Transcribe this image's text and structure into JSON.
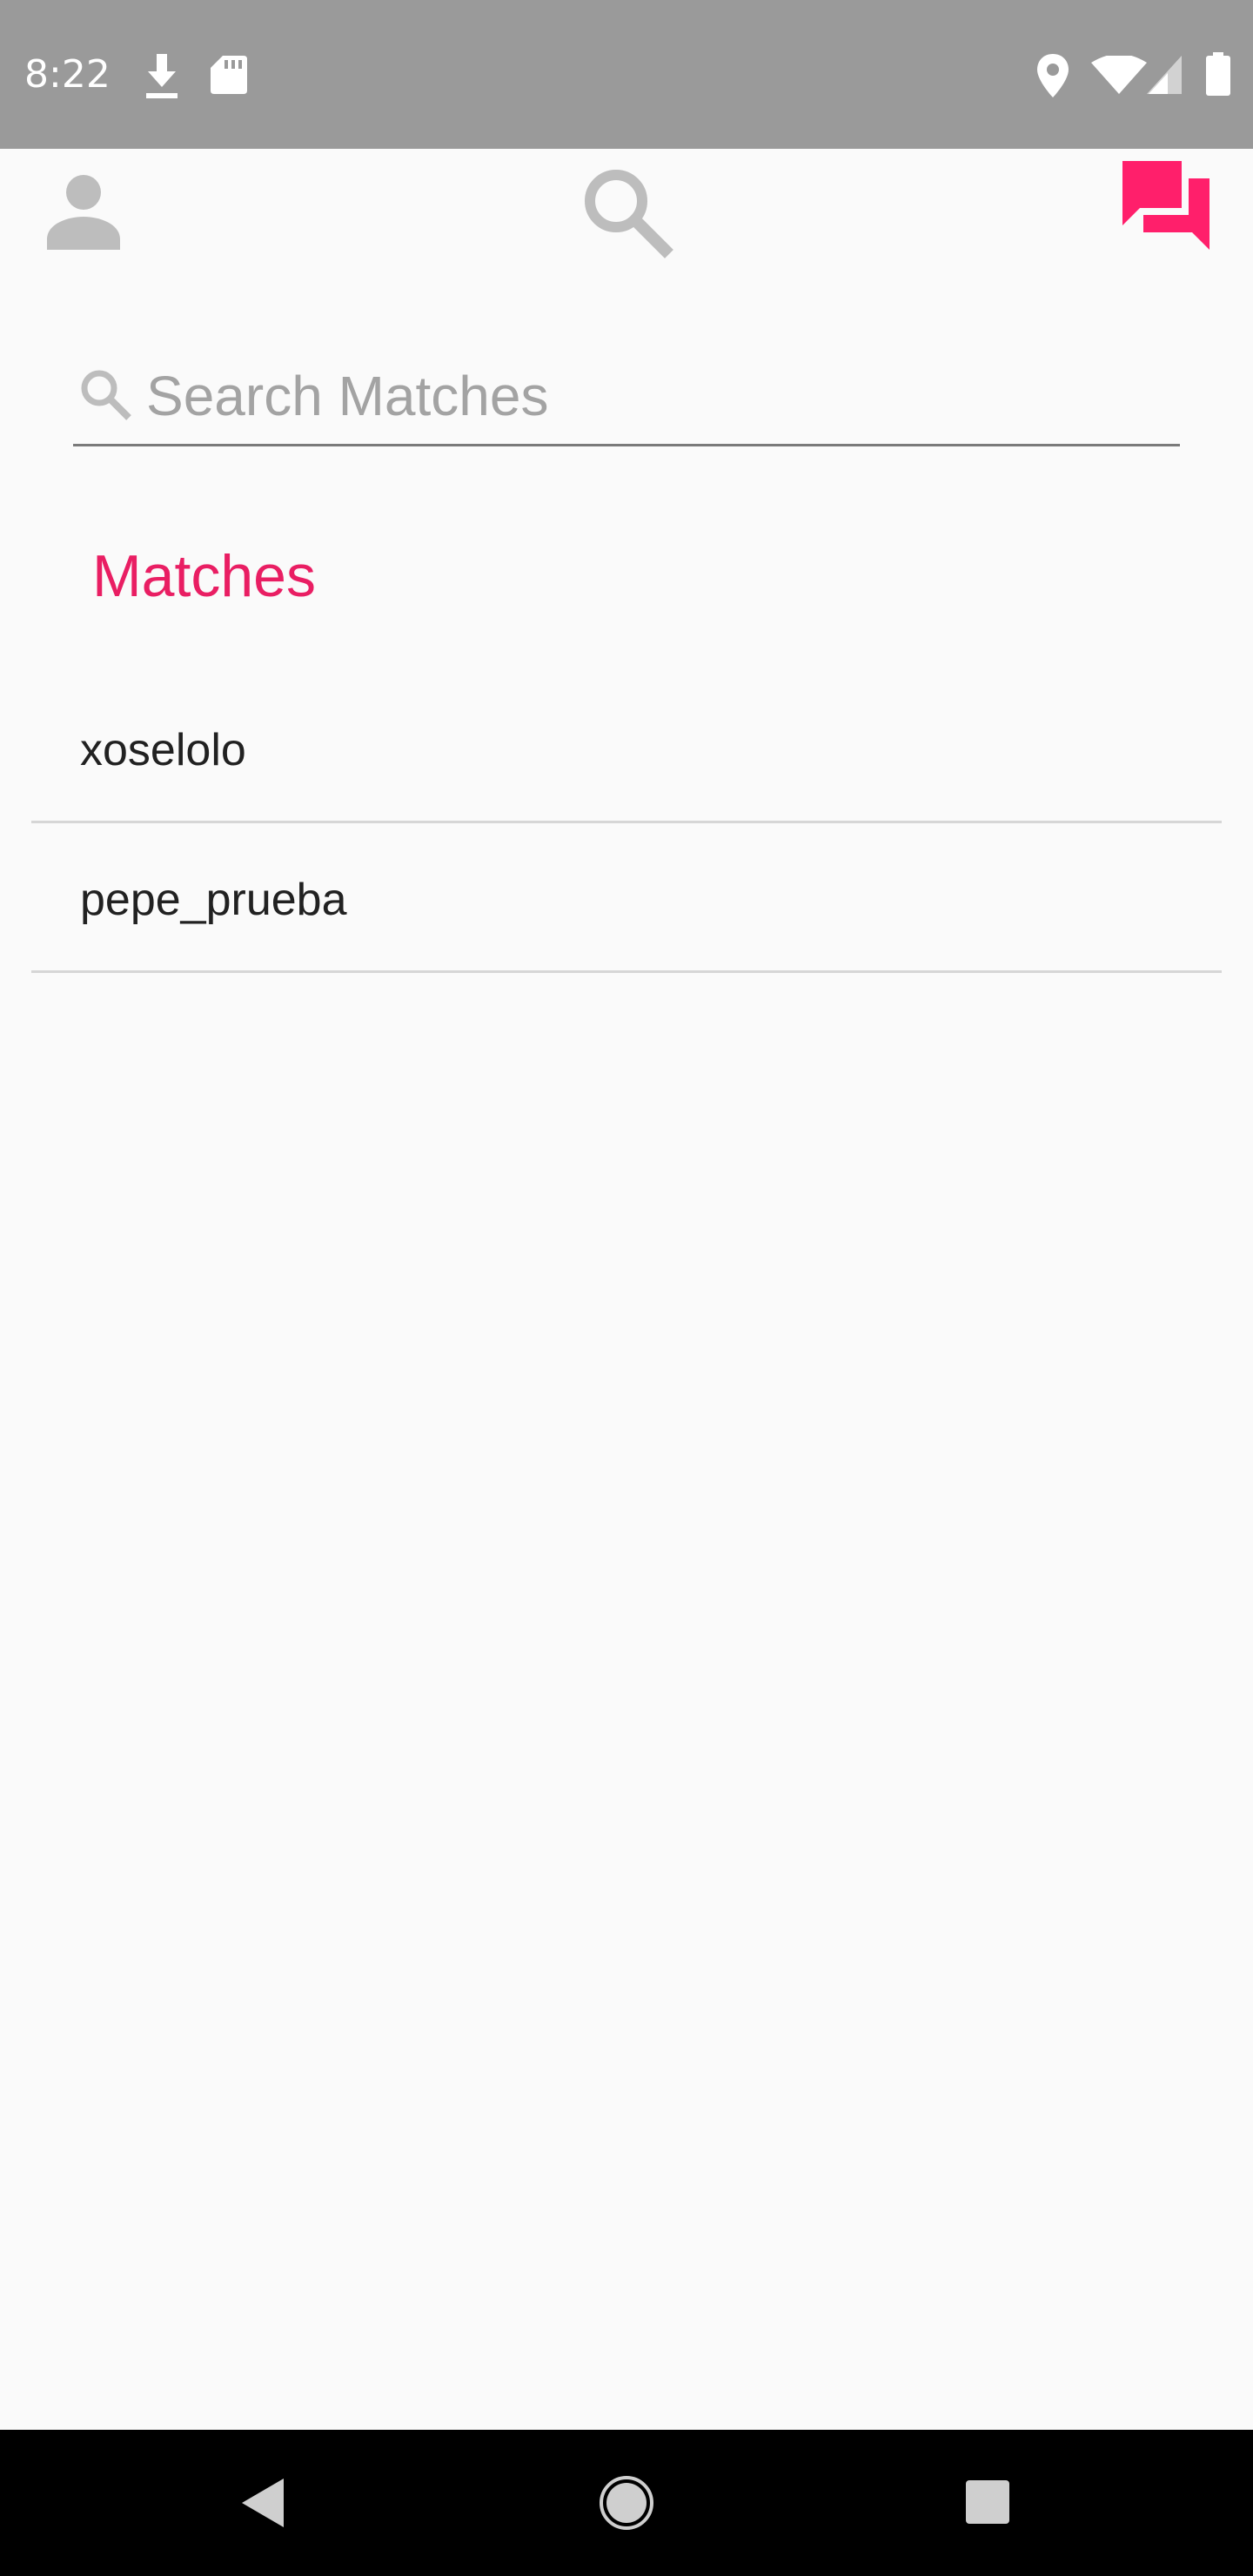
{
  "status_bar": {
    "time": "8:22",
    "icons": [
      "download-icon",
      "sd-card-icon",
      "location-icon",
      "wifi-icon",
      "cell-signal-icon",
      "battery-icon"
    ]
  },
  "top_nav": {
    "items": [
      {
        "name": "profile",
        "icon": "person-icon",
        "active": false
      },
      {
        "name": "search",
        "icon": "search-icon",
        "active": false
      },
      {
        "name": "matches",
        "icon": "chat-icon",
        "active": true
      }
    ],
    "active_color": "#ff1f6b",
    "inactive_color": "#bdbdbd"
  },
  "search": {
    "placeholder": "Search Matches",
    "value": ""
  },
  "section": {
    "title": "Matches",
    "color": "#e91e63"
  },
  "matches": [
    {
      "username": "xoselolo"
    },
    {
      "username": "pepe_prueba"
    }
  ],
  "nav_bar": {
    "buttons": [
      "back-icon",
      "home-icon",
      "recents-icon"
    ]
  }
}
